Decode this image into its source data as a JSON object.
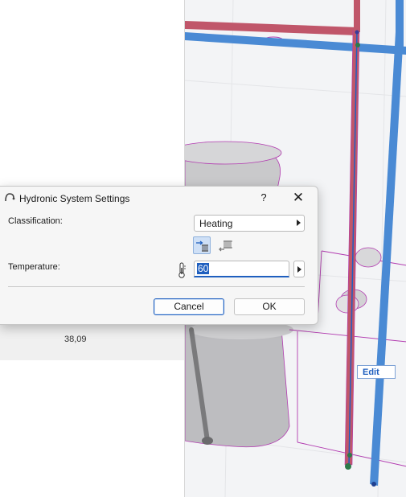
{
  "background": {
    "side_value": "38,09",
    "edit_label": "Edit"
  },
  "dialog": {
    "title": "Hydronic System Settings",
    "help": "?",
    "close": "✕",
    "classification_label": "Classification:",
    "classification_value": "Heating",
    "temperature_label": "Temperature:",
    "temperature_value": "60",
    "cancel_label": "Cancel",
    "ok_label": "OK"
  },
  "colors": {
    "accent": "#1f5fbf",
    "pipe_red": "#c0566a",
    "pipe_blue": "#4a8ad4",
    "outline_magenta": "#b23bb0"
  },
  "icons": [
    "hydronic-app-icon",
    "supply-mode-icon",
    "return-mode-icon",
    "thermometer-icon"
  ]
}
